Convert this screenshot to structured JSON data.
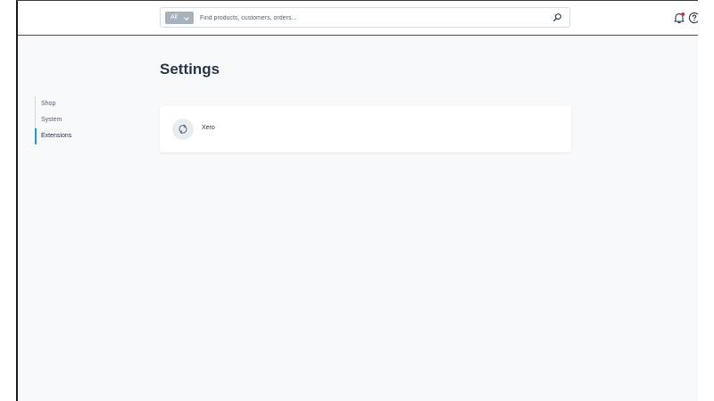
{
  "header": {
    "search": {
      "scope_label": "All",
      "placeholder": "Find products, customers, orders..."
    },
    "icons": {
      "search": "search-icon",
      "notifications": "bell-icon",
      "help": "help-icon"
    },
    "notification_dot_color": "#de294c"
  },
  "page": {
    "title": "Settings"
  },
  "sidebar": {
    "items": [
      {
        "label": "Shop",
        "active": false
      },
      {
        "label": "System",
        "active": false
      },
      {
        "label": "Extensions",
        "active": true
      }
    ],
    "accent_color": "#189eff"
  },
  "extensions": {
    "items": [
      {
        "label": "Xero",
        "icon": "sync-icon"
      }
    ]
  }
}
